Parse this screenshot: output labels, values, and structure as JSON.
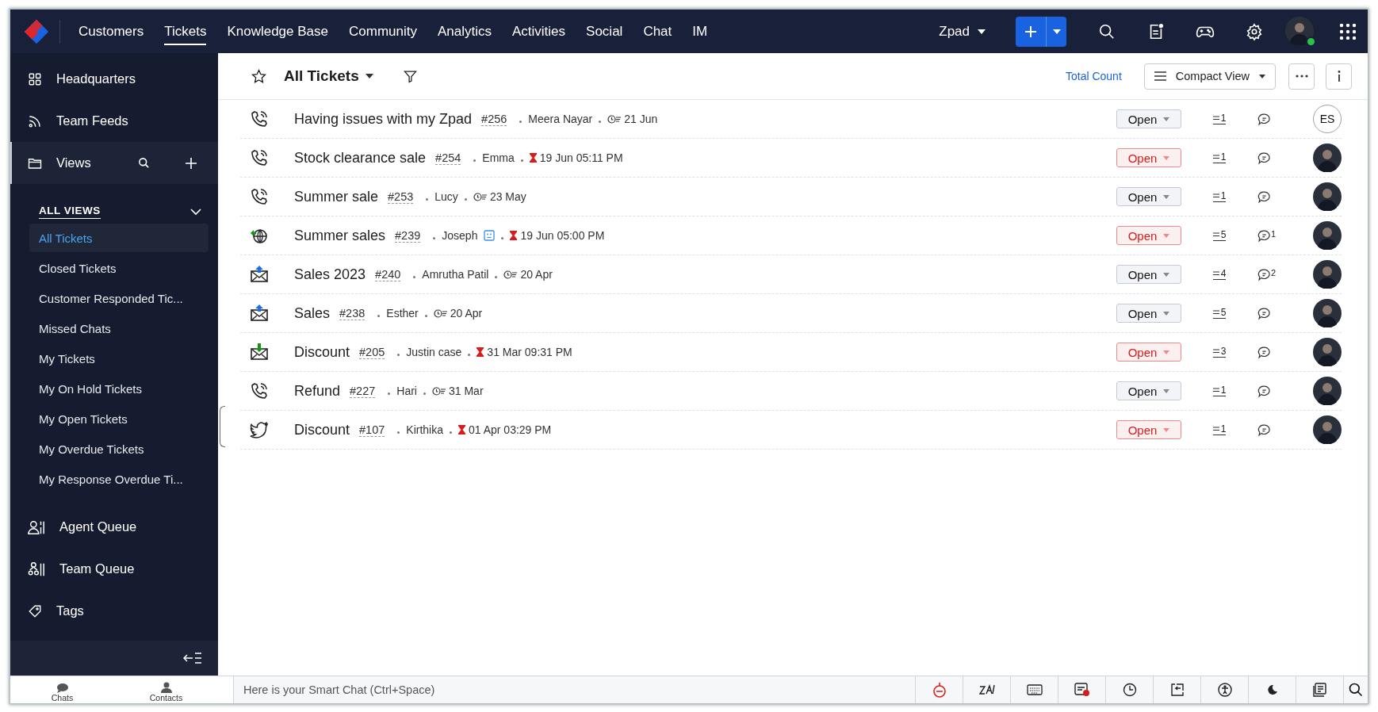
{
  "topbar": {
    "tabs": [
      {
        "label": "Customers",
        "selected": false
      },
      {
        "label": "Tickets",
        "selected": true
      },
      {
        "label": "Knowledge Base",
        "selected": false
      },
      {
        "label": "Community",
        "selected": false
      },
      {
        "label": "Analytics",
        "selected": false
      },
      {
        "label": "Activities",
        "selected": false
      },
      {
        "label": "Social",
        "selected": false
      },
      {
        "label": "Chat",
        "selected": false
      },
      {
        "label": "IM",
        "selected": false
      }
    ],
    "portal": "Zpad",
    "user_online": true
  },
  "sidebar": {
    "top_items": [
      {
        "kind": "grid",
        "label": "Headquarters"
      },
      {
        "kind": "feeds",
        "label": "Team Feeds"
      }
    ],
    "views": {
      "label": "Views",
      "heading": "ALL VIEWS",
      "expanded": true,
      "items": [
        {
          "label": "All Tickets",
          "selected": true
        },
        {
          "label": "Closed Tickets",
          "selected": false
        },
        {
          "label": "Customer Responded Tic...",
          "selected": false
        },
        {
          "label": "Missed Chats",
          "selected": false
        },
        {
          "label": "My Tickets",
          "selected": false
        },
        {
          "label": "My On Hold Tickets",
          "selected": false
        },
        {
          "label": "My Open Tickets",
          "selected": false
        },
        {
          "label": "My Overdue Tickets",
          "selected": false
        },
        {
          "label": "My Response Overdue Ti...",
          "selected": false
        }
      ]
    },
    "bottom_items": [
      {
        "kind": "agent",
        "label": "Agent Queue"
      },
      {
        "kind": "team",
        "label": "Team Queue"
      },
      {
        "kind": "tag",
        "label": "Tags"
      }
    ]
  },
  "header": {
    "view_title": "All Tickets",
    "total_count": "Total Count",
    "layout": "Compact View"
  },
  "tickets": [
    {
      "kind": "phone",
      "subject": "Having issues with my Zpad",
      "number": "#256",
      "contact": "Meera Nayar",
      "contact_badge": false,
      "overdue": false,
      "due": "21 Jun",
      "status": "Open",
      "threads": "1",
      "assignee": {
        "kind": "initials",
        "initials": "ES"
      }
    },
    {
      "kind": "phone",
      "subject": "Stock clearance sale",
      "number": "#254",
      "contact": "Emma",
      "contact_badge": false,
      "overdue": true,
      "due": "19 Jun 05:11 PM",
      "status": "Open",
      "threads": "1",
      "assignee": {
        "kind": "photo"
      }
    },
    {
      "kind": "phone",
      "subject": "Summer sale",
      "number": "#253",
      "contact": "Lucy",
      "contact_badge": false,
      "overdue": false,
      "due": "23 May",
      "status": "Open",
      "threads": "1",
      "assignee": {
        "kind": "photo"
      }
    },
    {
      "kind": "web",
      "subject": "Summer sales",
      "number": "#239",
      "contact": "Joseph",
      "contact_badge": true,
      "overdue": true,
      "due": "19 Jun 05:00 PM",
      "status": "Open",
      "threads": "5",
      "comments": "1",
      "assignee": {
        "kind": "photo"
      }
    },
    {
      "kind": "email_out",
      "subject": "Sales 2023",
      "number": "#240",
      "contact": "Amrutha Patil",
      "contact_badge": false,
      "overdue": false,
      "due": "20 Apr",
      "status": "Open",
      "threads": "4",
      "comments": "2",
      "assignee": {
        "kind": "photo"
      }
    },
    {
      "kind": "email_out",
      "subject": "Sales",
      "number": "#238",
      "contact": "Esther",
      "contact_badge": false,
      "overdue": false,
      "due": "20 Apr",
      "status": "Open",
      "threads": "5",
      "assignee": {
        "kind": "photo"
      }
    },
    {
      "kind": "email_in",
      "subject": "Discount",
      "number": "#205",
      "contact": "Justin case",
      "contact_badge": false,
      "overdue": true,
      "due": "31 Mar 09:31 PM",
      "status": "Open",
      "threads": "3",
      "assignee": {
        "kind": "photo"
      }
    },
    {
      "kind": "phone",
      "subject": "Refund",
      "number": "#227",
      "contact": "Hari",
      "contact_badge": false,
      "overdue": false,
      "due": "31 Mar",
      "status": "Open",
      "threads": "1",
      "assignee": {
        "kind": "photo"
      }
    },
    {
      "kind": "twitter",
      "subject": "Discount",
      "number": "#107",
      "contact": "Kirthika",
      "contact_badge": false,
      "overdue": true,
      "due": "01 Apr 03:29 PM",
      "status": "Open",
      "threads": "1",
      "assignee": {
        "kind": "photo"
      }
    }
  ],
  "bottombar": {
    "chats": "Chats",
    "contacts": "Contacts",
    "smart_chat": {
      "placeholder": "Here is your Smart Chat (Ctrl+Space)"
    }
  }
}
